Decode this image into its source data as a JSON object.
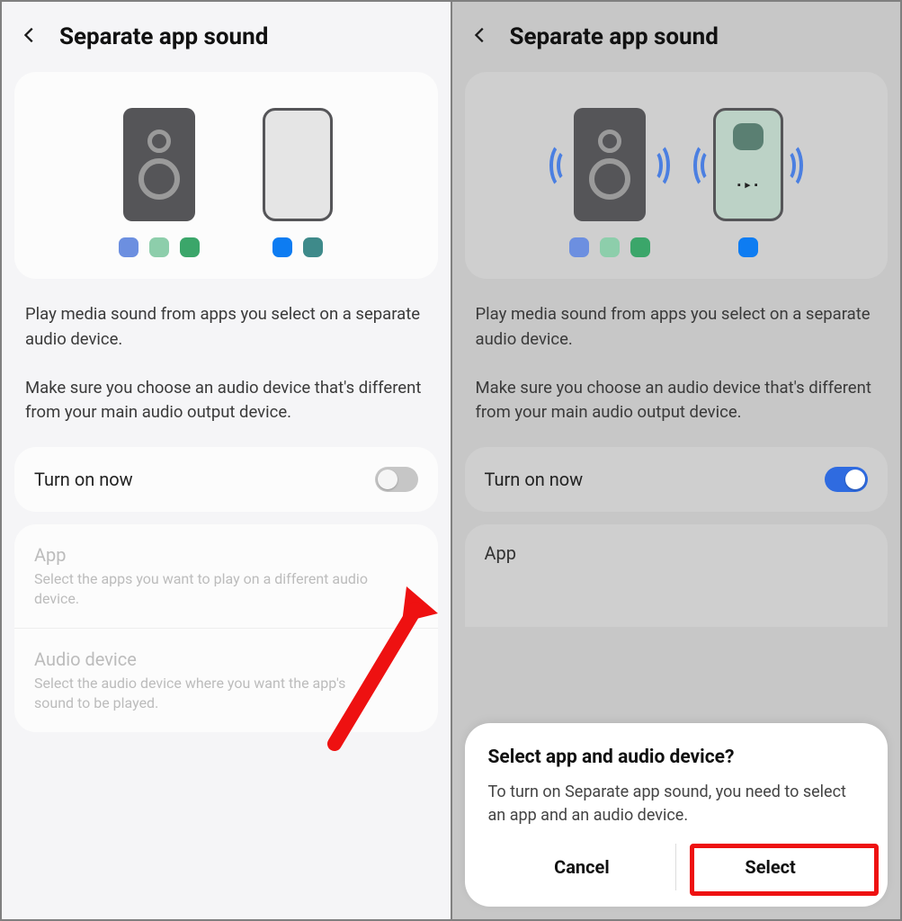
{
  "left": {
    "header_title": "Separate app sound",
    "desc_p1": "Play media sound from apps you select on a separate audio device.",
    "desc_p2": "Make sure you choose an audio device that's different from your main audio output device.",
    "row_turn_on": "Turn on now",
    "row_app_label": "App",
    "row_app_sub": "Select the apps you want to play on a different audio device.",
    "row_audio_label": "Audio device",
    "row_audio_sub": "Select the audio device where you want the app's sound to be played."
  },
  "right": {
    "header_title": "Separate app sound",
    "desc_p1": "Play media sound from apps you select on a separate audio device.",
    "desc_p2": "Make sure you choose an audio device that's different from your main audio output device.",
    "row_turn_on": "Turn on now",
    "row_app_label": "App",
    "dialog_title": "Select app and audio device?",
    "dialog_body": "To turn on Separate app sound, you need to select an app and an audio device.",
    "dialog_cancel": "Cancel",
    "dialog_select": "Select"
  }
}
